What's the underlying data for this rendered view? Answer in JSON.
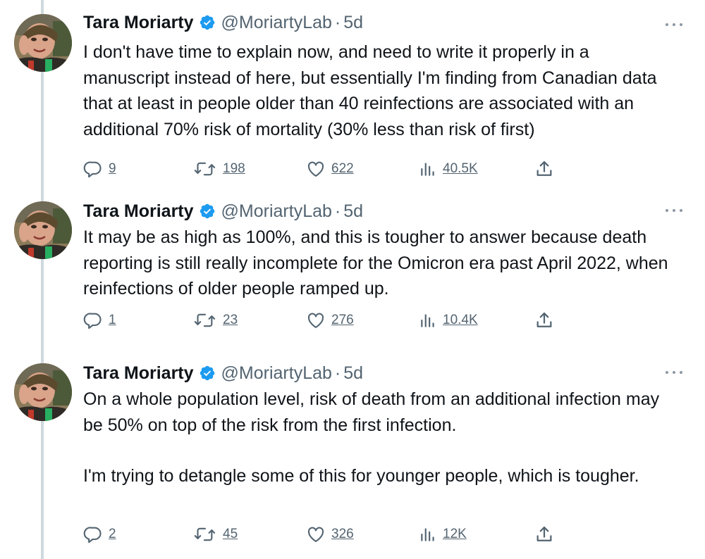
{
  "tweets": [
    {
      "author": "Tara Moriarty",
      "handle": "@MoriartyLab",
      "dot": "·",
      "time": "5d",
      "paragraphs": [
        "I don't have time to explain now, and need to write it properly in a manuscript instead of here, but essentially I'm finding from Canadian data that at least in people older than 40 reinfections are associated with an additional 70% risk of mortality (30% less than risk of first)"
      ],
      "replies": "9",
      "retweets": "198",
      "likes": "622",
      "views": "40.5K"
    },
    {
      "author": "Tara Moriarty",
      "handle": "@MoriartyLab",
      "dot": "·",
      "time": "5d",
      "paragraphs": [
        "It may be as high as 100%, and this is tougher to answer because death reporting is still really incomplete for the Omicron era past April 2022, when reinfections of older people ramped up."
      ],
      "replies": "1",
      "retweets": "23",
      "likes": "276",
      "views": "10.4K"
    },
    {
      "author": "Tara Moriarty",
      "handle": "@MoriartyLab",
      "dot": "·",
      "time": "5d",
      "paragraphs": [
        "On a whole population level, risk of death from an additional infection may be 50% on top of the risk from the first infection.",
        "I'm trying to detangle some of this for younger people, which is tougher."
      ],
      "replies": "2",
      "retweets": "45",
      "likes": "326",
      "views": "12K"
    }
  ],
  "icons": {
    "verified": "verified-badge-icon",
    "more": "more-options-icon",
    "reply": "reply-icon",
    "retweet": "retweet-icon",
    "like": "heart-icon",
    "views": "views-icon",
    "share": "share-icon"
  },
  "colors": {
    "verified": "#1d9bf0",
    "muted": "#536471",
    "thread_line": "#cfd9de",
    "text": "#0f1419"
  }
}
